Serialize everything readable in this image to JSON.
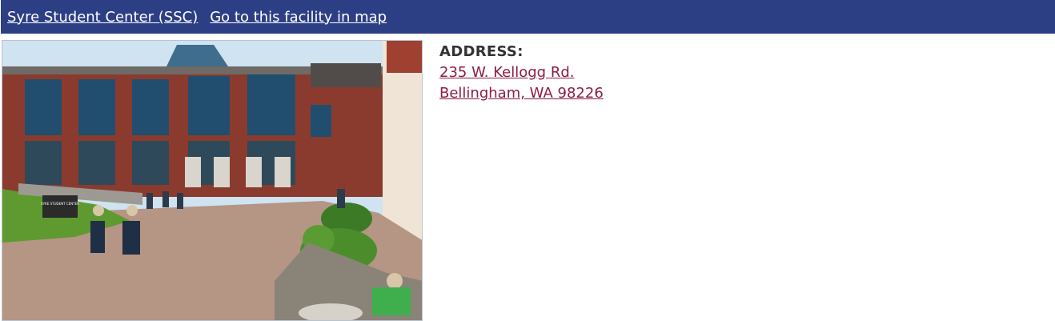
{
  "header": {
    "facility_name": "Syre Student Center (SSC)",
    "map_link": "Go to this facility in map"
  },
  "photo": {
    "alt": "Syre Student Center building exterior",
    "sign_text": "SYRE STUDENT CENTER"
  },
  "address": {
    "label": "ADDRESS:",
    "street": "235 W. Kellogg Rd.",
    "city_state_zip": "Bellingham, WA 98226"
  },
  "colors": {
    "header_bg": "#2d3f84",
    "link_color": "#8c1d40"
  }
}
